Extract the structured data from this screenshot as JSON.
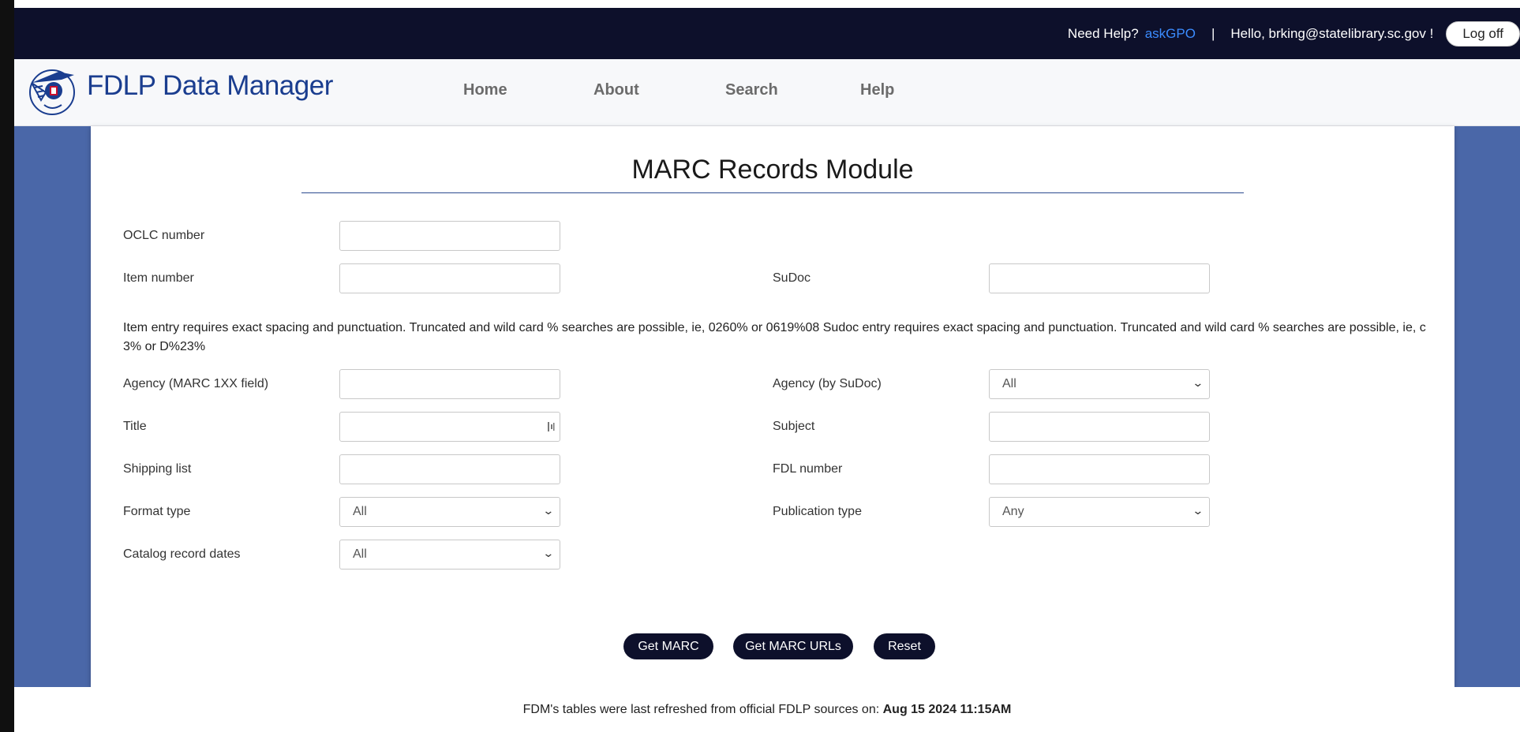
{
  "topbar": {
    "help_label": "Need Help?",
    "help_link": "askGPO",
    "separator": "|",
    "greeting": "Hello, brking@statelibrary.sc.gov !",
    "logoff_label": "Log off"
  },
  "navbar": {
    "brand": "FDLP Data Manager",
    "links": [
      "Home",
      "About",
      "Search",
      "Help"
    ]
  },
  "form": {
    "title": "MARC Records Module",
    "fields": {
      "oclc_label": "OCLC number",
      "item_label": "Item number",
      "sudoc_label": "SuDoc",
      "agency_marc_label": "Agency (MARC 1XX field)",
      "agency_sudoc_label": "Agency (by SuDoc)",
      "agency_sudoc_value": "All",
      "title_label": "Title",
      "subject_label": "Subject",
      "shipping_label": "Shipping list",
      "fdl_label": "FDL number",
      "format_label": "Format type",
      "format_value": "All",
      "pubtype_label": "Publication type",
      "pubtype_value": "Any",
      "catdates_label": "Catalog record dates",
      "catdates_value": "All"
    },
    "note": "Item entry requires exact spacing and punctuation. Truncated and wild card % searches are possible, ie, 0260% or 0619%08 Sudoc entry requires exact spacing and punctuation. Truncated and wild card % searches are possible, ie, c 3% or D%23%",
    "buttons": {
      "get_marc": "Get MARC",
      "get_marc_urls": "Get MARC URLs",
      "reset": "Reset"
    }
  },
  "footer": {
    "text": "FDM's tables were last refreshed from official FDLP sources on:",
    "date": "Aug 15 2024 11:15AM"
  },
  "colors": {
    "topbar": "#0d102b",
    "page_background": "#4a67a8",
    "brand": "#1a3d8f",
    "link": "#3b8cff"
  }
}
